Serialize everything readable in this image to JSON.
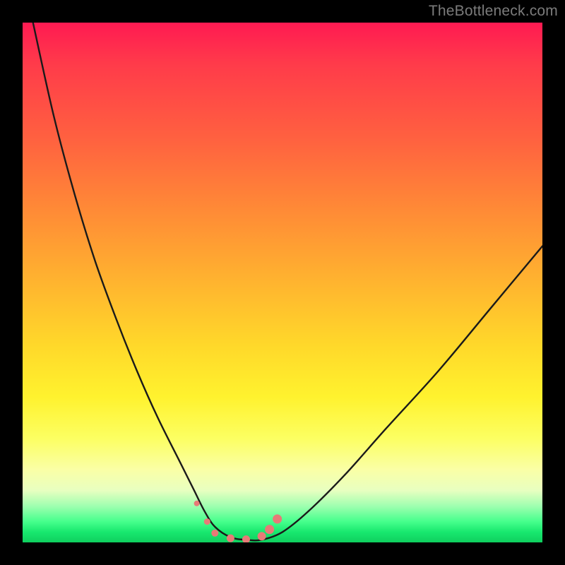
{
  "watermark": {
    "text": "TheBottleneck.com"
  },
  "colors": {
    "frame_background": "#000000",
    "curve_stroke": "#1a1a1a",
    "marker_fill": "#e77a77",
    "gradient_stops": [
      "#ff1a52",
      "#ff3b4a",
      "#ff6040",
      "#ff8a36",
      "#ffb42f",
      "#ffd82a",
      "#fff22e",
      "#fcff62",
      "#faffa6",
      "#e8ffc0",
      "#9fffb0",
      "#46ff8c",
      "#18e86f",
      "#0fcf5e"
    ]
  },
  "chart_data": {
    "type": "line",
    "title": "",
    "xlabel": "",
    "ylabel": "",
    "xlim": [
      0,
      100
    ],
    "ylim": [
      0,
      100
    ],
    "grid": false,
    "legend": false,
    "series": [
      {
        "name": "bottleneck-curve",
        "x": [
          2,
          6,
          10,
          14,
          18,
          22,
          26,
          30,
          33,
          35,
          37,
          40,
          43,
          46,
          50,
          55,
          62,
          70,
          80,
          90,
          100
        ],
        "y": [
          100,
          82,
          67,
          54,
          43,
          33,
          24,
          16,
          10,
          6,
          3,
          1,
          0.5,
          0.5,
          2,
          6,
          13,
          22,
          33,
          45,
          57
        ]
      }
    ],
    "markers": {
      "name": "optimal-range",
      "x": [
        33.5,
        35.5,
        37,
        40,
        43,
        46,
        47.5,
        49
      ],
      "y": [
        7.5,
        4,
        1.8,
        0.8,
        0.6,
        1.2,
        2.5,
        4.5
      ],
      "r": [
        4,
        4.5,
        5,
        5.5,
        5.5,
        6,
        6.5,
        6.5
      ]
    }
  }
}
